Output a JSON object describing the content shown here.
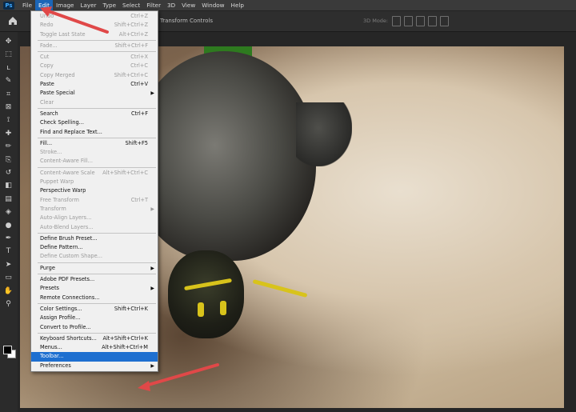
{
  "menubar": {
    "logo": "Ps",
    "items": [
      "File",
      "Edit",
      "Image",
      "Layer",
      "Type",
      "Select",
      "Filter",
      "3D",
      "View",
      "Window",
      "Help"
    ],
    "active_index": 1
  },
  "optionsbar": {
    "transform_label": "Transform Controls",
    "brush_label": "3D Mode:"
  },
  "edit_menu": {
    "items": [
      {
        "label": "Undo",
        "shortcut": "Ctrl+Z",
        "disabled": true
      },
      {
        "label": "Redo",
        "shortcut": "Shift+Ctrl+Z",
        "disabled": true
      },
      {
        "label": "Toggle Last State",
        "shortcut": "Alt+Ctrl+Z",
        "disabled": true
      },
      {
        "separator": true
      },
      {
        "label": "Fade...",
        "shortcut": "Shift+Ctrl+F",
        "disabled": true
      },
      {
        "separator": true
      },
      {
        "label": "Cut",
        "shortcut": "Ctrl+X",
        "disabled": true
      },
      {
        "label": "Copy",
        "shortcut": "Ctrl+C",
        "disabled": true
      },
      {
        "label": "Copy Merged",
        "shortcut": "Shift+Ctrl+C",
        "disabled": true
      },
      {
        "label": "Paste",
        "shortcut": "Ctrl+V",
        "disabled": false
      },
      {
        "label": "Paste Special",
        "submenu": true,
        "disabled": false
      },
      {
        "label": "Clear",
        "disabled": true
      },
      {
        "separator": true
      },
      {
        "label": "Search",
        "shortcut": "Ctrl+F",
        "disabled": false
      },
      {
        "label": "Check Spelling...",
        "disabled": false
      },
      {
        "label": "Find and Replace Text...",
        "disabled": false
      },
      {
        "separator": true
      },
      {
        "label": "Fill...",
        "shortcut": "Shift+F5",
        "disabled": false
      },
      {
        "label": "Stroke...",
        "disabled": true
      },
      {
        "label": "Content-Aware Fill...",
        "disabled": true
      },
      {
        "separator": true
      },
      {
        "label": "Content-Aware Scale",
        "shortcut": "Alt+Shift+Ctrl+C",
        "disabled": true
      },
      {
        "label": "Puppet Warp",
        "disabled": true
      },
      {
        "label": "Perspective Warp",
        "disabled": false
      },
      {
        "label": "Free Transform",
        "shortcut": "Ctrl+T",
        "disabled": true
      },
      {
        "label": "Transform",
        "submenu": true,
        "disabled": true
      },
      {
        "label": "Auto-Align Layers...",
        "disabled": true
      },
      {
        "label": "Auto-Blend Layers...",
        "disabled": true
      },
      {
        "separator": true
      },
      {
        "label": "Define Brush Preset...",
        "disabled": false
      },
      {
        "label": "Define Pattern...",
        "disabled": false
      },
      {
        "label": "Define Custom Shape...",
        "disabled": true
      },
      {
        "separator": true
      },
      {
        "label": "Purge",
        "submenu": true,
        "disabled": false
      },
      {
        "separator": true
      },
      {
        "label": "Adobe PDF Presets...",
        "disabled": false
      },
      {
        "label": "Presets",
        "submenu": true,
        "disabled": false
      },
      {
        "label": "Remote Connections...",
        "disabled": false
      },
      {
        "separator": true
      },
      {
        "label": "Color Settings...",
        "shortcut": "Shift+Ctrl+K",
        "disabled": false
      },
      {
        "label": "Assign Profile...",
        "disabled": false
      },
      {
        "label": "Convert to Profile...",
        "disabled": false
      },
      {
        "separator": true
      },
      {
        "label": "Keyboard Shortcuts...",
        "shortcut": "Alt+Shift+Ctrl+K",
        "disabled": false
      },
      {
        "label": "Menus...",
        "shortcut": "Alt+Shift+Ctrl+M",
        "disabled": false
      },
      {
        "label": "Toolbar...",
        "disabled": false,
        "highlight": true
      },
      {
        "label": "Preferences",
        "submenu": true,
        "disabled": false
      }
    ]
  },
  "tools": [
    "move-tool",
    "marquee-tool",
    "lasso-tool",
    "quick-select-tool",
    "crop-tool",
    "frame-tool",
    "eyedropper-tool",
    "healing-tool",
    "brush-tool",
    "stamp-tool",
    "history-brush-tool",
    "eraser-tool",
    "gradient-tool",
    "blur-tool",
    "dodge-tool",
    "pen-tool",
    "type-tool",
    "path-select-tool",
    "shape-tool",
    "hand-tool",
    "zoom-tool"
  ],
  "colors": {
    "menu_highlight": "#1e6fd0",
    "annotation_arrow": "#e04848"
  }
}
